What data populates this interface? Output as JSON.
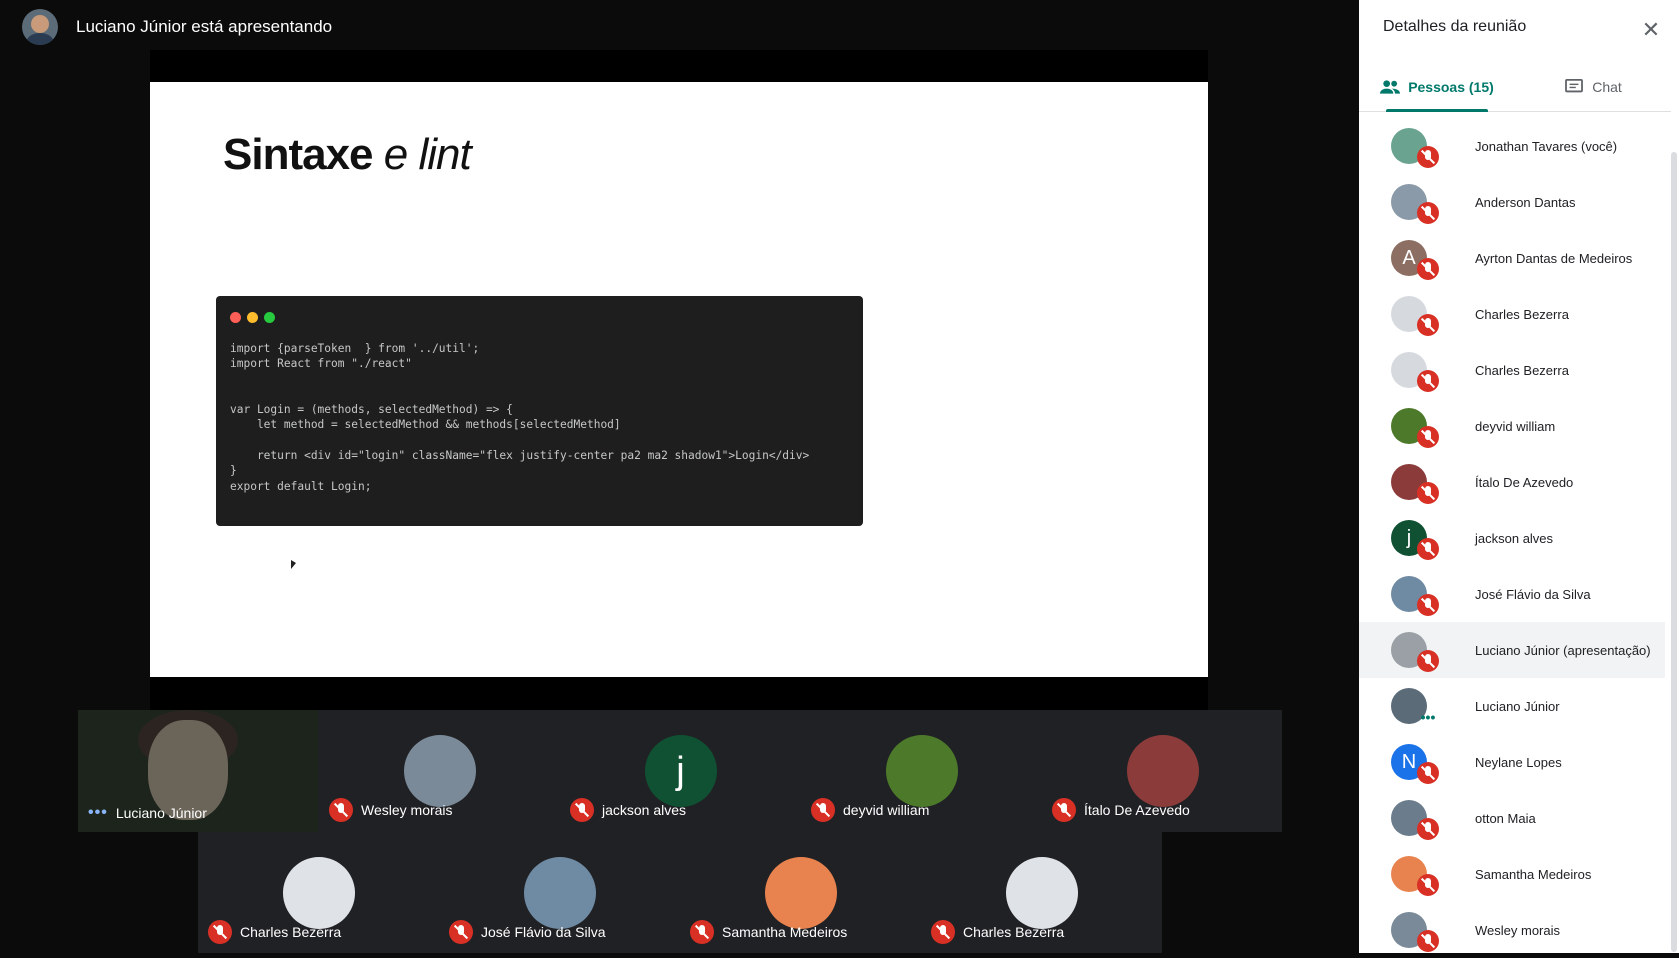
{
  "presenter": {
    "text": "Luciano Júnior está apresentando"
  },
  "slide": {
    "title_bold": "Sintaxe",
    "title_italic": "e lint",
    "code_lines": [
      "import {parseToken  } from '../util';",
      "import React from \"./react\"",
      "",
      "",
      "var Login = (methods, selectedMethod) => {",
      "    let method = selectedMethod && methods[selectedMethod]",
      "",
      "    return <div id=\"login\" className=\"flex justify-center pa2 ma2 shadow1\">Login</div>",
      "}",
      "export default Login;"
    ],
    "dot_colors": [
      "#ff5f56",
      "#ffbd2e",
      "#27c93f"
    ]
  },
  "tiles_row1": [
    {
      "name": "Luciano Júnior",
      "camera": true,
      "speaking": true
    },
    {
      "name": "Wesley morais",
      "color": "#7a8a99"
    },
    {
      "name": "jackson alves",
      "letter": "j",
      "color": "#0f5132"
    },
    {
      "name": "deyvid william",
      "color": "#4d7a2a"
    },
    {
      "name": "Ítalo De Azevedo",
      "color": "#8c3b3b"
    }
  ],
  "tiles_row2": [
    {
      "name": "Charles Bezerra",
      "color": "#dfe3e8"
    },
    {
      "name": "José Flávio da Silva",
      "color": "#6f8aa3"
    },
    {
      "name": "Samantha Medeiros",
      "color": "#e8834f"
    },
    {
      "name": "Charles Bezerra",
      "color": "#dfe3e8"
    }
  ],
  "panel": {
    "title": "Detalhes da reunião",
    "tabs": {
      "people": "Pessoas (15)",
      "chat": "Chat"
    },
    "accent": "#00796b",
    "people": [
      {
        "name": "Jonathan Tavares (você)",
        "color": "#6aa38f"
      },
      {
        "name": "Anderson Dantas",
        "color": "#8b9aa8"
      },
      {
        "name": "Ayrton Dantas de Medeiros",
        "letter": "A",
        "color": "#8d6e63"
      },
      {
        "name": "Charles Bezerra",
        "color": "#d6dadf"
      },
      {
        "name": "Charles Bezerra",
        "color": "#d6dadf"
      },
      {
        "name": "deyvid william",
        "color": "#4d7a2a"
      },
      {
        "name": "Ítalo De Azevedo",
        "color": "#8c3b3b"
      },
      {
        "name": "jackson alves",
        "letter": "j",
        "color": "#0f5132"
      },
      {
        "name": "José Flávio da Silva",
        "color": "#6f8aa3"
      },
      {
        "name": "Luciano Júnior (apresentação)",
        "color": "#9aa0a6",
        "presenting": true
      },
      {
        "name": "Luciano Júnior",
        "color": "#5b6b78",
        "speaking": true
      },
      {
        "name": "Neylane Lopes",
        "letter": "N",
        "color": "#1a73e8"
      },
      {
        "name": "otton Maia",
        "color": "#6b7c8c"
      },
      {
        "name": "Samantha Medeiros",
        "color": "#e8834f"
      },
      {
        "name": "Wesley morais",
        "color": "#7a8a99"
      }
    ]
  }
}
